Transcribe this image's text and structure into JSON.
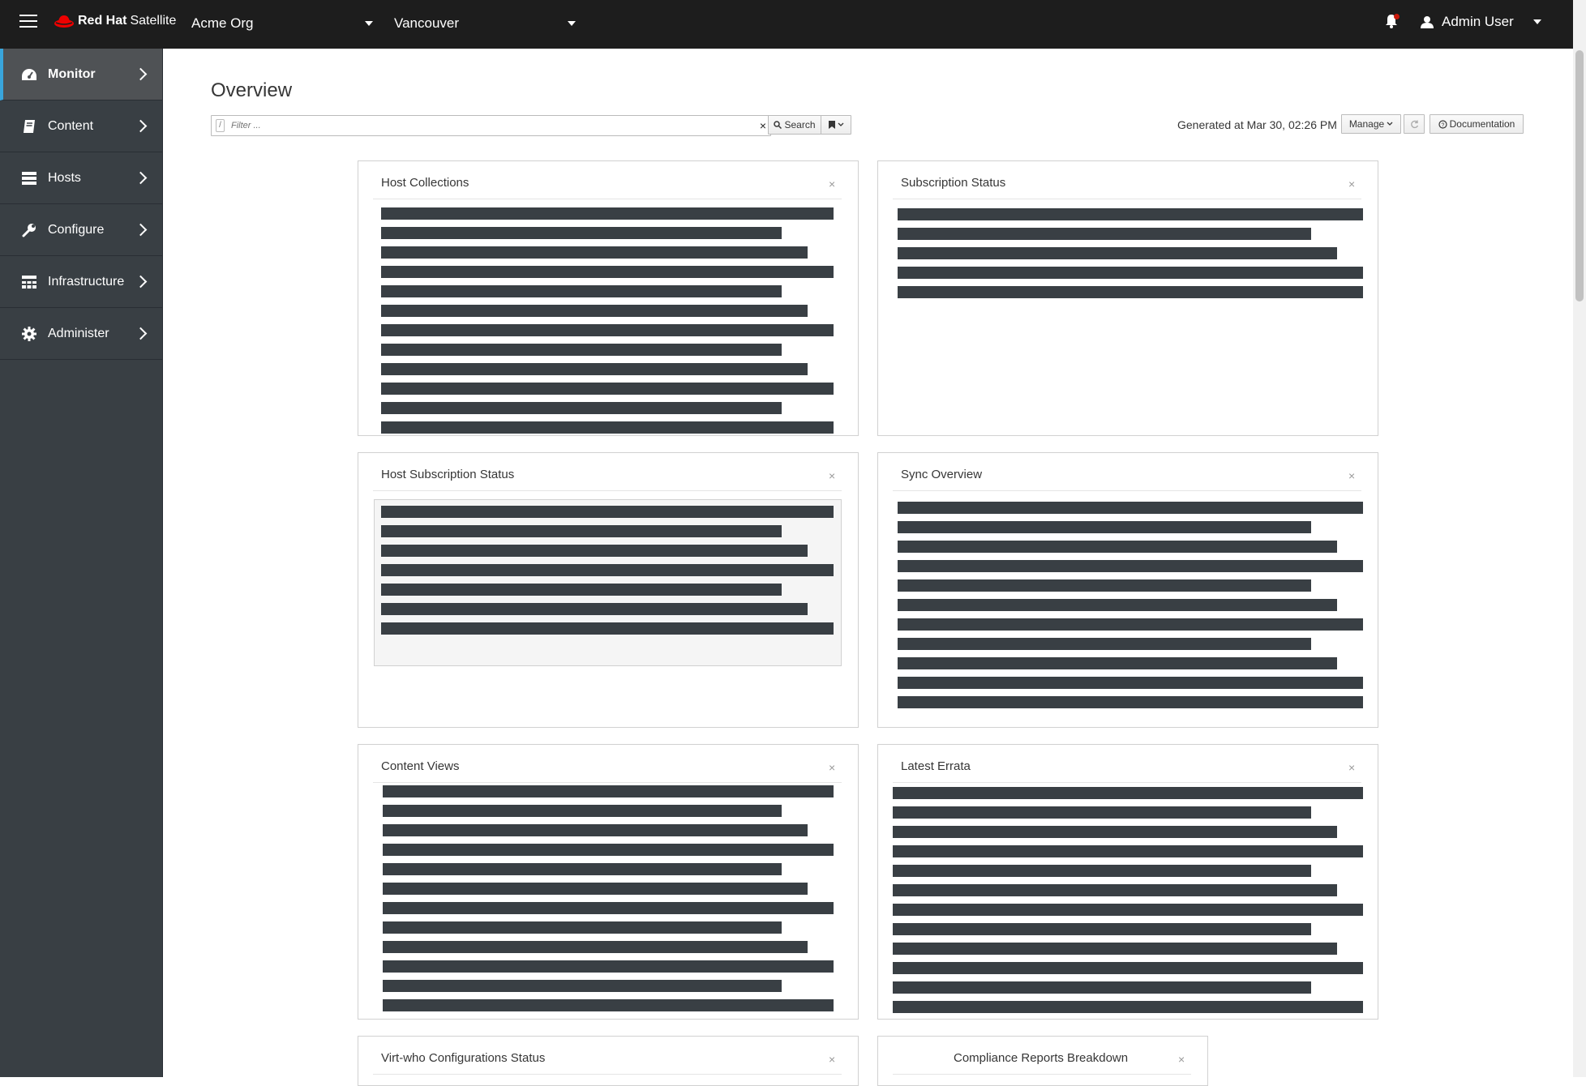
{
  "brand": {
    "redhat": "Red Hat",
    "product": "Satellite"
  },
  "context": {
    "organization": "Acme Org",
    "location": "Vancouver"
  },
  "user": {
    "name": "Admin User"
  },
  "nav": {
    "items": [
      {
        "label": "Monitor",
        "icon": "dashboard-icon"
      },
      {
        "label": "Content",
        "icon": "book-icon"
      },
      {
        "label": "Hosts",
        "icon": "server-icon"
      },
      {
        "label": "Configure",
        "icon": "wrench-icon"
      },
      {
        "label": "Infrastructure",
        "icon": "network-icon"
      },
      {
        "label": "Administer",
        "icon": "gear-icon"
      }
    ]
  },
  "page": {
    "title": "Overview",
    "search": {
      "placeholder": "Filter ...",
      "button": "Search"
    },
    "generated": "Generated at Mar 30, 02:26 PM",
    "manage": "Manage",
    "documentation": "Documentation"
  },
  "widgets": [
    {
      "title": "Host Collections"
    },
    {
      "title": "Subscription Status"
    },
    {
      "title": "Host Subscription Status"
    },
    {
      "title": "Sync Overview"
    },
    {
      "title": "Content Views"
    },
    {
      "title": "Latest Errata"
    },
    {
      "title": "Virt-who Configurations Status"
    },
    {
      "title": "Compliance Reports Breakdown"
    }
  ],
  "colors": {
    "topbar": "#1d1d1d",
    "sidebar": "#393f44",
    "accent": "#39a5dc",
    "redacted_bar": "#393f44"
  }
}
